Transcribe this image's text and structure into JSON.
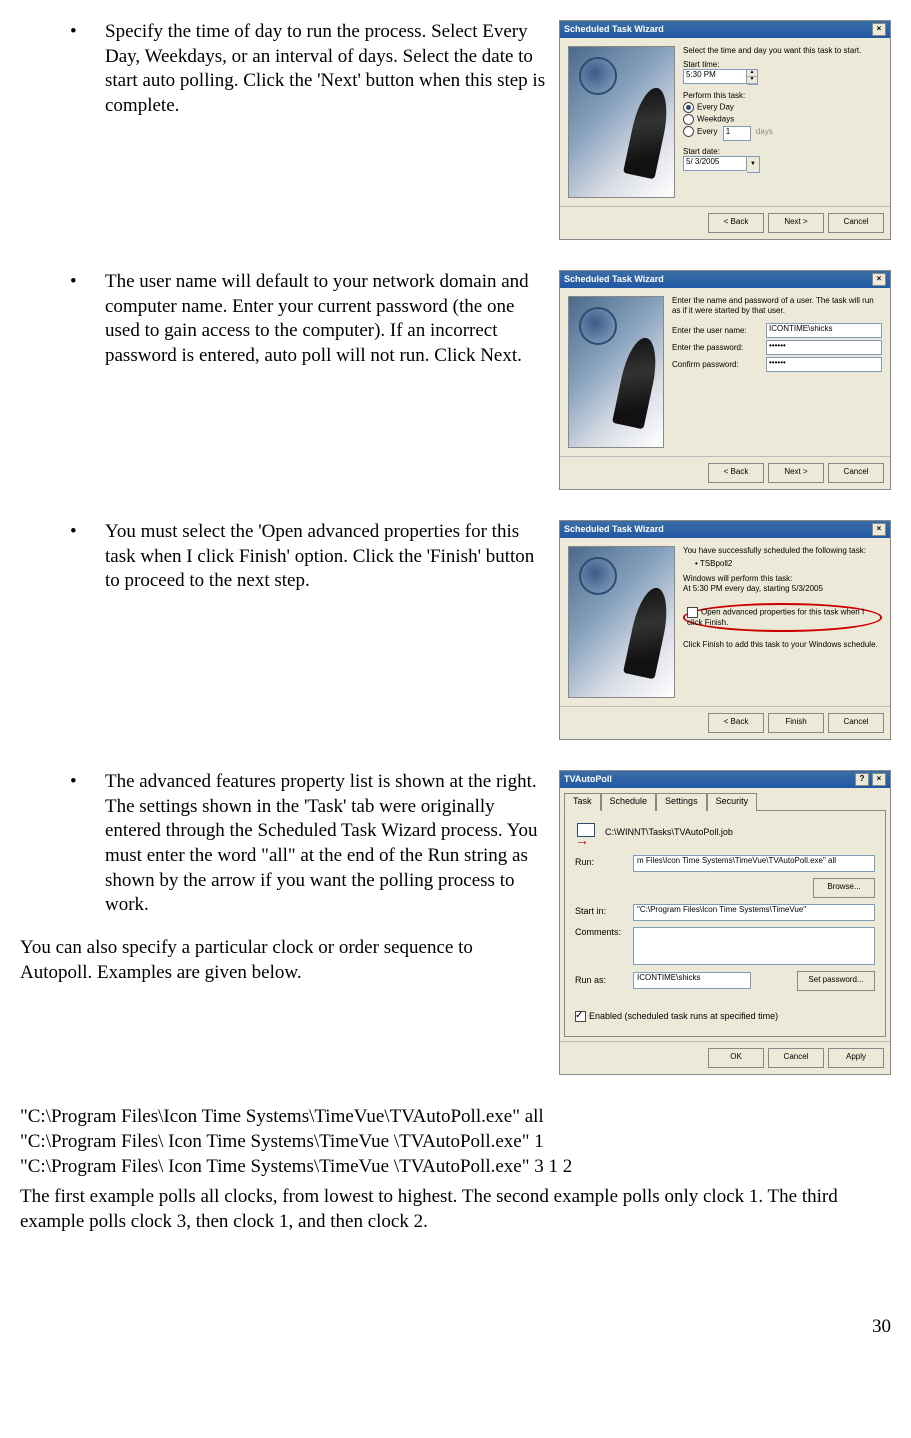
{
  "bullets": [
    "Specify the time of day to run the process.  Select Every Day, Weekdays, or an interval of days.  Select the date to start auto polling.  Click the 'Next' button when this step is complete.",
    "The user name will default to your network domain and computer name.  Enter your current password (the one used to gain access to the computer).  If an incorrect password is entered, auto poll will not run.  Click Next.",
    "You must select the 'Open advanced properties for this task when I click Finish' option.  Click the 'Finish' button to proceed to the next step.",
    "The advanced features property list is shown at the right.   The settings shown in the 'Task' tab were originally entered through the Scheduled Task Wizard process.  You must enter the word \"all\" at the end of the Run string as shown by the arrow if you want the polling process to work."
  ],
  "para_autopoll": "You can also specify a particular clock or order sequence to Autopoll.  Examples are given below.",
  "examples": [
    "\"C:\\Program Files\\Icon Time Systems\\TimeVue\\TVAutoPoll.exe\" all",
    "\"C:\\Program Files\\ Icon Time Systems\\TimeVue \\TVAutoPoll.exe\" 1",
    "\"C:\\Program Files\\ Icon Time Systems\\TimeVue \\TVAutoPoll.exe\" 3 1 2"
  ],
  "para_final": "The first example polls all clocks, from lowest to highest.  The second example polls only clock 1.  The third example polls clock 3, then clock 1, and then clock 2.",
  "page_num": "30",
  "wiz": {
    "title": "Scheduled Task Wizard",
    "close": "×",
    "help": "?",
    "back": "< Back",
    "next": "Next >",
    "finish": "Finish",
    "cancel": "Cancel",
    "w1": {
      "line1": "Select the time and day you want this task to start.",
      "start_time_lbl": "Start time:",
      "start_time_val": "5:30 PM",
      "perform_lbl": "Perform this task:",
      "r1": "Every Day",
      "r2": "Weekdays",
      "r3": "Every",
      "r3_val": "1",
      "r3_unit": "days",
      "start_date_lbl": "Start date:",
      "start_date_val": "5/ 3/2005"
    },
    "w2": {
      "line1": "Enter the name and password of a user. The task will run as if it were started by that user.",
      "user_lbl": "Enter the user name:",
      "user_val": "ICONTIME\\shicks",
      "pass_lbl": "Enter the password:",
      "pass_val": "••••••",
      "conf_lbl": "Confirm password:",
      "conf_val": "••••••"
    },
    "w3": {
      "line1": "You have successfully scheduled the following task:",
      "task_name": "TSBpoll2",
      "line2": "Windows will perform this task:",
      "line3": "At 5:30 PM every day, starting 5/3/2005",
      "adv_lbl": "Open advanced properties for this task when I click Finish.",
      "line4": "Click Finish to add this task to your Windows schedule."
    }
  },
  "prop": {
    "title": "TVAutoPoll",
    "tabs": [
      "Task",
      "Schedule",
      "Settings",
      "Security"
    ],
    "job": "C:\\WINNT\\Tasks\\TVAutoPoll.job",
    "run_lbl": "Run:",
    "run_val": "m Files\\Icon Time Systems\\TimeVue\\TVAutoPoll.exe\" all",
    "browse": "Browse...",
    "startin_lbl": "Start in:",
    "startin_val": "\"C:\\Program Files\\Icon Time Systems\\TimeVue\"",
    "comments_lbl": "Comments:",
    "runas_lbl": "Run as:",
    "runas_val": "ICONTIME\\shicks",
    "setpw": "Set password...",
    "enabled_lbl": "Enabled (scheduled task runs at specified time)",
    "ok": "OK",
    "cancel": "Cancel",
    "apply": "Apply"
  }
}
